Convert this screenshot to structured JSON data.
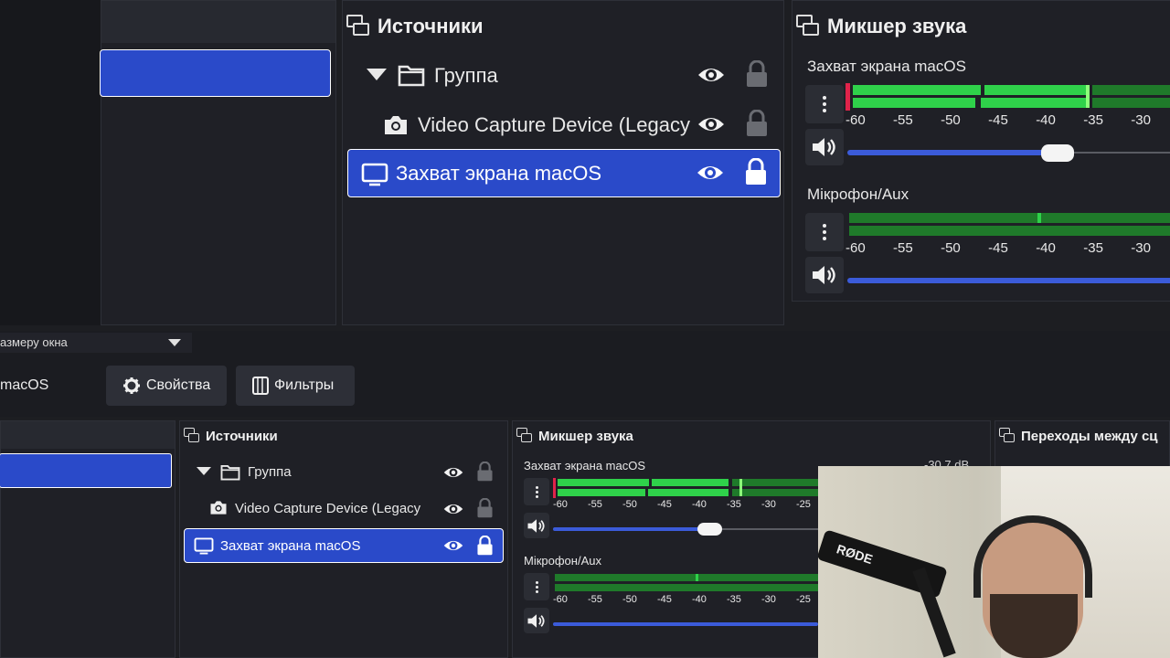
{
  "top": {
    "sources": {
      "title": "Источники",
      "items": [
        {
          "label": "Группа",
          "icon": "folder-icon",
          "expanded": true,
          "selected": false
        },
        {
          "label": "Video Capture Device (Legacy",
          "icon": "camera-icon",
          "selected": false
        },
        {
          "label": "Захват экрана macOS",
          "icon": "monitor-icon",
          "selected": true
        }
      ]
    },
    "mixer": {
      "title": "Микшер звука",
      "channels": [
        {
          "name": "Захват экрана macOS",
          "ticks": [
            "-60",
            "-55",
            "-50",
            "-45",
            "-40",
            "-35",
            "-30"
          ],
          "volume": 0.75
        },
        {
          "name": "Мікрофон/Aux",
          "ticks": [
            "-60",
            "-55",
            "-50",
            "-45",
            "-40",
            "-35",
            "-30"
          ],
          "volume": 1.0
        }
      ]
    }
  },
  "middle": {
    "scale_select": "азмеру окна",
    "source_name": "macOS",
    "properties_label": "Свойства",
    "filters_label": "Фильтры"
  },
  "bottom": {
    "sources": {
      "title": "Источники",
      "items": [
        {
          "label": "Группа"
        },
        {
          "label": "Video Capture Device (Legacy"
        },
        {
          "label": "Захват экрана macOS"
        }
      ]
    },
    "mixer": {
      "title": "Микшер звука",
      "db_readout": "-30.7 dB",
      "channels": [
        {
          "name": "Захват экрана macOS",
          "ticks": [
            "-60",
            "-55",
            "-50",
            "-45",
            "-40",
            "-35",
            "-30",
            "-25"
          ],
          "volume": 0.75
        },
        {
          "name": "Мікрофон/Aux",
          "ticks": [
            "-60",
            "-55",
            "-50",
            "-45",
            "-40",
            "-35",
            "-30",
            "-25"
          ],
          "volume": 1.0
        }
      ]
    },
    "transitions": {
      "title": "Переходы между сц"
    }
  },
  "webcam": {
    "mic_brand": "RØDE"
  },
  "colors": {
    "accent": "#2a4ac9",
    "meter_green": "#2fd14a",
    "meter_dark_green": "#1f7a2a",
    "meter_red": "#e0234a",
    "slider": "#3b5bd9"
  }
}
